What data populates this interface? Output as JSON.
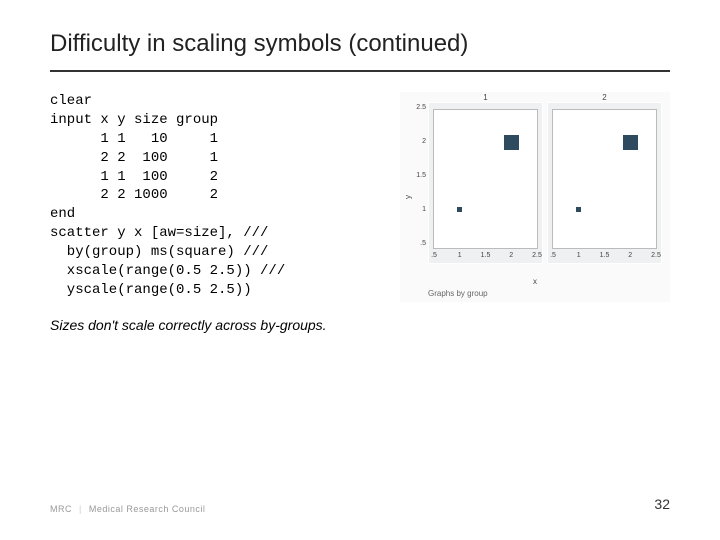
{
  "title": "Difficulty in scaling symbols (continued)",
  "code": "clear\ninput x y size group\n      1 1   10     1\n      2 2  100     1\n      1 1  100     2\n      2 2 1000     2\nend\nscatter y x [aw=size], ///\n  by(group) ms(square) ///\n  xscale(range(0.5 2.5)) ///\n  yscale(range(0.5 2.5))",
  "caption": "Sizes don't scale correctly across by-groups.",
  "chart": {
    "ylabel": "y",
    "xlabel": "x",
    "sub": "Graphs by group",
    "panel1": "1",
    "panel2": "2",
    "yt1": ".5",
    "yt2": "1",
    "yt3": "1.5",
    "yt4": "2",
    "yt5": "2.5",
    "xt1": ".5",
    "xt2": "1",
    "xt3": "1.5",
    "xt4": "2",
    "xt5": "2.5"
  },
  "footer": {
    "logo": "MRC",
    "org": "Medical Research Council"
  },
  "page": "32",
  "chart_data": [
    {
      "type": "scatter",
      "title": "1",
      "x": [
        1,
        2
      ],
      "y": [
        1,
        2
      ],
      "size": [
        10,
        100
      ],
      "xlabel": "x",
      "ylabel": "y",
      "xlim": [
        0.5,
        2.5
      ],
      "ylim": [
        0.5,
        2.5
      ]
    },
    {
      "type": "scatter",
      "title": "2",
      "x": [
        1,
        2
      ],
      "y": [
        1,
        2
      ],
      "size": [
        100,
        1000
      ],
      "xlabel": "x",
      "ylabel": "y",
      "xlim": [
        0.5,
        2.5
      ],
      "ylim": [
        0.5,
        2.5
      ]
    }
  ]
}
